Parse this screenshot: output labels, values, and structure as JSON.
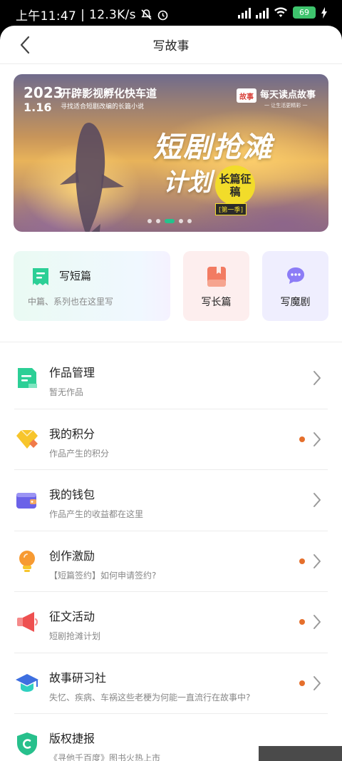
{
  "status_bar": {
    "time": "上午11:47",
    "speed": "12.3K/s",
    "battery": "69"
  },
  "header": {
    "title": "写故事"
  },
  "banner": {
    "year": "2023",
    "date": "1.16",
    "line1": "开辟影视孵化快车道",
    "line2": "寻找适合短剧改编的长篇小说",
    "logo": "故事",
    "brand": "每天读点故事",
    "brand_sub": "一 让生活更精彩 一",
    "title1": "短剧抢滩",
    "title2": "计划",
    "badge": "长篇征稿",
    "tag": "[第一季]",
    "slide_count": 5,
    "active_slide": 3
  },
  "write_cards": {
    "short": {
      "title": "写短篇",
      "subtitle": "中篇、系列也在这里写"
    },
    "long": {
      "title": "写长篇"
    },
    "magic": {
      "title": "写魔剧"
    }
  },
  "menu": [
    {
      "title": "作品管理",
      "subtitle": "暂无作品",
      "dot": false,
      "icon": "document-icon"
    },
    {
      "title": "我的积分",
      "subtitle": "作品产生的积分",
      "dot": true,
      "icon": "diamond-icon"
    },
    {
      "title": "我的钱包",
      "subtitle": "作品产生的收益都在这里",
      "dot": false,
      "icon": "wallet-icon"
    },
    {
      "title": "创作激励",
      "subtitle": "【短篇签约】如何申请签约?",
      "dot": true,
      "icon": "lightbulb-icon"
    },
    {
      "title": "征文活动",
      "subtitle": "短剧抢滩计划",
      "dot": true,
      "icon": "megaphone-icon"
    },
    {
      "title": "故事研习社",
      "subtitle": "失忆、疾病、车祸这些老梗为何能一直流行在故事中?",
      "dot": true,
      "icon": "graduation-cap-icon"
    },
    {
      "title": "版权捷报",
      "subtitle": "《寻他千百度》图书火热上市",
      "dot": false,
      "icon": "shield-icon"
    }
  ],
  "colors": {
    "accent": "#23c38d",
    "dot": "#e56f2c"
  }
}
